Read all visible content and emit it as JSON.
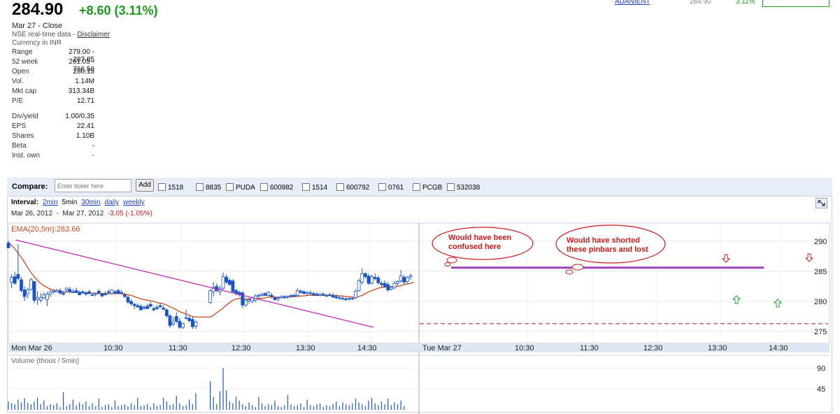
{
  "quote": {
    "price": "284.90",
    "change": "+8.60 (3.11%)",
    "close_label": "Mar 27 - Close",
    "source": "NSE real-time data - ",
    "disclaimer": "Disclaimer",
    "currency": "Currency in INR",
    "stats": [
      {
        "label": "Range",
        "value": "279.00 - 287.85"
      },
      {
        "label": "52 week",
        "value": "261.05 - 766.50"
      },
      {
        "label": "Open",
        "value": "280.15"
      },
      {
        "label": "Vol.",
        "value": "1.14M"
      },
      {
        "label": "Mkt cap",
        "value": "313.34B"
      },
      {
        "label": "P/E",
        "value": "12.71"
      },
      {
        "label": "Div/yield",
        "value": "1.00/0.35"
      },
      {
        "label": "EPS",
        "value": "22.41"
      },
      {
        "label": "Shares",
        "value": "1.10B"
      },
      {
        "label": "Beta",
        "value": "-"
      },
      {
        "label": "Inst. own",
        "value": "-"
      }
    ]
  },
  "peer": {
    "ticker": "ADANIENT",
    "price": "284.90",
    "change": "3.11%"
  },
  "compare": {
    "label": "Compare:",
    "placeholder": "Enter ticker here",
    "add_label": "Add",
    "tickers": [
      "1518",
      "8835",
      "PUDA",
      "600982",
      "1514",
      "600792",
      "0761",
      "PCGB",
      "532038"
    ]
  },
  "interval": {
    "label": "Interval:",
    "options": [
      "2min",
      "5min",
      "30min",
      "daily",
      "weekly"
    ],
    "selected": "5min",
    "start_date": "Mar 26, 2012",
    "end_date": "Mar 27, 2012",
    "period_change": "-3.05 (-1.05%)"
  },
  "colors": {
    "up": "#ffffff",
    "down": "#1a55c8",
    "ema": "#cc4a1a",
    "trendline": "#c020b0",
    "resistance": "#a040c0",
    "support": "#a0102a",
    "volume": "#1a55c8"
  },
  "chart_data": {
    "type": "candlestick",
    "ema_label": "EMA(20,5m):283.66",
    "y_ticks": [
      290,
      285,
      280,
      275
    ],
    "ylim": [
      273.5,
      293
    ],
    "x_labels": [
      "Mon Mar 26",
      "10:30",
      "11:30",
      "12:30",
      "13:30",
      "14:30",
      "Tue Mar 27",
      "10:30",
      "11:30",
      "12:30",
      "13:30",
      "14:30"
    ],
    "candles": [
      {
        "o": 289.7,
        "h": 290.1,
        "l": 288.9,
        "c": 288.9
      },
      {
        "o": 283.2,
        "h": 284.5,
        "l": 282.2,
        "c": 284.0
      },
      {
        "o": 284.1,
        "h": 284.9,
        "l": 282.8,
        "c": 283.0
      },
      {
        "o": 284.5,
        "h": 289.5,
        "l": 283.5,
        "c": 283.8
      },
      {
        "o": 283.6,
        "h": 284.0,
        "l": 281.5,
        "c": 281.8
      },
      {
        "o": 281.9,
        "h": 282.5,
        "l": 280.1,
        "c": 280.8
      },
      {
        "o": 281.3,
        "h": 282.3,
        "l": 280.5,
        "c": 281.9
      },
      {
        "o": 282.0,
        "h": 283.9,
        "l": 281.8,
        "c": 283.6
      },
      {
        "o": 283.3,
        "h": 283.4,
        "l": 279.7,
        "c": 280.2
      },
      {
        "o": 280.3,
        "h": 281.7,
        "l": 279.4,
        "c": 280.6
      },
      {
        "o": 280.2,
        "h": 281.4,
        "l": 279.8,
        "c": 280.6
      },
      {
        "o": 280.6,
        "h": 281.5,
        "l": 280.4,
        "c": 281.1
      },
      {
        "o": 280.3,
        "h": 281.6,
        "l": 279.2,
        "c": 281.2
      },
      {
        "o": 281.2,
        "h": 282.0,
        "l": 280.7,
        "c": 281.6
      },
      {
        "o": 281.6,
        "h": 281.9,
        "l": 281.3,
        "c": 281.7
      },
      {
        "o": 281.6,
        "h": 282.1,
        "l": 281.5,
        "c": 281.8
      },
      {
        "o": 281.8,
        "h": 282.2,
        "l": 281.1,
        "c": 281.4
      },
      {
        "o": 281.4,
        "h": 281.7,
        "l": 281.0,
        "c": 281.2
      },
      {
        "o": 281.9,
        "h": 282.3,
        "l": 281.4,
        "c": 282.2
      },
      {
        "o": 282.0,
        "h": 282.4,
        "l": 281.3,
        "c": 281.6
      },
      {
        "o": 281.6,
        "h": 282.1,
        "l": 281.4,
        "c": 281.5
      },
      {
        "o": 281.8,
        "h": 282.3,
        "l": 281.4,
        "c": 281.5
      },
      {
        "o": 281.5,
        "h": 281.8,
        "l": 281.0,
        "c": 281.1
      },
      {
        "o": 281.6,
        "h": 281.9,
        "l": 281.3,
        "c": 281.4
      },
      {
        "o": 281.4,
        "h": 281.7,
        "l": 280.9,
        "c": 281.2
      },
      {
        "o": 281.6,
        "h": 281.9,
        "l": 281.2,
        "c": 281.3
      },
      {
        "o": 281.1,
        "h": 281.4,
        "l": 280.9,
        "c": 281.0
      },
      {
        "o": 281.2,
        "h": 281.5,
        "l": 280.8,
        "c": 281.3
      },
      {
        "o": 281.7,
        "h": 282.0,
        "l": 281.3,
        "c": 281.4
      },
      {
        "o": 281.2,
        "h": 281.5,
        "l": 280.7,
        "c": 280.9
      },
      {
        "o": 281.3,
        "h": 281.7,
        "l": 281.0,
        "c": 281.1
      },
      {
        "o": 281.6,
        "h": 282.0,
        "l": 281.2,
        "c": 281.5
      },
      {
        "o": 281.3,
        "h": 282.0,
        "l": 281.1,
        "c": 281.9
      },
      {
        "o": 281.6,
        "h": 281.9,
        "l": 281.2,
        "c": 281.4
      },
      {
        "o": 281.8,
        "h": 282.1,
        "l": 281.2,
        "c": 281.3
      },
      {
        "o": 281.4,
        "h": 281.9,
        "l": 281.1,
        "c": 281.5
      },
      {
        "o": 281.1,
        "h": 281.4,
        "l": 280.6,
        "c": 280.8
      },
      {
        "o": 280.7,
        "h": 281.0,
        "l": 279.6,
        "c": 279.9
      },
      {
        "o": 280.0,
        "h": 280.3,
        "l": 279.3,
        "c": 279.6
      },
      {
        "o": 279.5,
        "h": 279.8,
        "l": 278.7,
        "c": 279.3
      },
      {
        "o": 279.3,
        "h": 279.7,
        "l": 278.9,
        "c": 279.1
      },
      {
        "o": 279.2,
        "h": 279.5,
        "l": 278.5,
        "c": 278.6
      },
      {
        "o": 279.0,
        "h": 279.4,
        "l": 278.6,
        "c": 278.9
      },
      {
        "o": 279.2,
        "h": 279.6,
        "l": 278.7,
        "c": 278.8
      },
      {
        "o": 279.5,
        "h": 279.9,
        "l": 279.0,
        "c": 279.2
      },
      {
        "o": 278.8,
        "h": 279.2,
        "l": 278.4,
        "c": 278.6
      },
      {
        "o": 279.0,
        "h": 279.4,
        "l": 278.6,
        "c": 278.8
      },
      {
        "o": 279.3,
        "h": 279.8,
        "l": 278.9,
        "c": 279.1
      },
      {
        "o": 278.9,
        "h": 279.4,
        "l": 278.5,
        "c": 278.7
      },
      {
        "o": 278.6,
        "h": 278.8,
        "l": 277.3,
        "c": 277.6
      },
      {
        "o": 277.6,
        "h": 277.9,
        "l": 275.6,
        "c": 276.0
      },
      {
        "o": 276.2,
        "h": 277.4,
        "l": 275.9,
        "c": 276.5
      },
      {
        "o": 277.5,
        "h": 278.2,
        "l": 276.4,
        "c": 276.7
      },
      {
        "o": 276.7,
        "h": 277.2,
        "l": 275.4,
        "c": 275.7
      },
      {
        "o": 275.7,
        "h": 276.5,
        "l": 275.4,
        "c": 276.3
      },
      {
        "o": 277.3,
        "h": 278.6,
        "l": 277.0,
        "c": 277.2
      },
      {
        "o": 277.2,
        "h": 277.6,
        "l": 276.5,
        "c": 276.8
      },
      {
        "o": 277.0,
        "h": 277.5,
        "l": 275.4,
        "c": 275.8
      },
      {
        "o": 275.9,
        "h": 276.8,
        "l": 275.4,
        "c": 276.6
      },
      {
        "o": 279.8,
        "h": 282.0,
        "l": 279.6,
        "c": 281.8
      },
      {
        "o": 281.6,
        "h": 283.2,
        "l": 280.8,
        "c": 282.3
      },
      {
        "o": 282.5,
        "h": 283.0,
        "l": 281.5,
        "c": 281.8
      },
      {
        "o": 281.6,
        "h": 282.6,
        "l": 281.0,
        "c": 282.1
      },
      {
        "o": 282.2,
        "h": 284.8,
        "l": 281.9,
        "c": 284.1
      },
      {
        "o": 284.0,
        "h": 284.5,
        "l": 282.9,
        "c": 283.2
      },
      {
        "o": 283.5,
        "h": 283.8,
        "l": 282.6,
        "c": 282.8
      },
      {
        "o": 283.4,
        "h": 283.7,
        "l": 281.5,
        "c": 281.6
      },
      {
        "o": 281.8,
        "h": 282.1,
        "l": 281.0,
        "c": 281.3
      },
      {
        "o": 281.5,
        "h": 281.8,
        "l": 280.8,
        "c": 281.1
      },
      {
        "o": 281.4,
        "h": 281.7,
        "l": 278.9,
        "c": 279.4
      },
      {
        "o": 279.4,
        "h": 280.4,
        "l": 279.1,
        "c": 280.2
      },
      {
        "o": 280.1,
        "h": 280.6,
        "l": 279.6,
        "c": 280.3
      },
      {
        "o": 280.0,
        "h": 280.8,
        "l": 279.7,
        "c": 280.6
      },
      {
        "o": 280.2,
        "h": 281.2,
        "l": 279.9,
        "c": 280.9
      },
      {
        "o": 280.9,
        "h": 281.3,
        "l": 280.5,
        "c": 281.0
      },
      {
        "o": 281.0,
        "h": 281.4,
        "l": 280.8,
        "c": 281.2
      },
      {
        "o": 281.3,
        "h": 281.5,
        "l": 280.9,
        "c": 281.0
      },
      {
        "o": 281.0,
        "h": 281.7,
        "l": 280.8,
        "c": 281.5
      },
      {
        "o": 281.0,
        "h": 281.4,
        "l": 280.6,
        "c": 280.8
      },
      {
        "o": 280.6,
        "h": 280.9,
        "l": 280.1,
        "c": 280.3
      },
      {
        "o": 280.4,
        "h": 280.8,
        "l": 280.0,
        "c": 280.6
      },
      {
        "o": 280.6,
        "h": 281.0,
        "l": 280.4,
        "c": 280.8
      },
      {
        "o": 280.8,
        "h": 281.1,
        "l": 280.5,
        "c": 280.6
      },
      {
        "o": 280.7,
        "h": 281.0,
        "l": 280.4,
        "c": 280.8
      },
      {
        "o": 280.9,
        "h": 281.2,
        "l": 280.6,
        "c": 281.0
      },
      {
        "o": 281.0,
        "h": 281.3,
        "l": 280.7,
        "c": 280.9
      },
      {
        "o": 281.0,
        "h": 282.2,
        "l": 280.8,
        "c": 281.8
      },
      {
        "o": 281.7,
        "h": 282.0,
        "l": 281.3,
        "c": 281.5
      },
      {
        "o": 281.6,
        "h": 281.9,
        "l": 281.2,
        "c": 281.3
      },
      {
        "o": 281.3,
        "h": 281.7,
        "l": 281.0,
        "c": 281.5
      },
      {
        "o": 281.4,
        "h": 281.8,
        "l": 281.1,
        "c": 281.3
      },
      {
        "o": 281.3,
        "h": 281.6,
        "l": 280.9,
        "c": 281.1
      },
      {
        "o": 281.2,
        "h": 281.5,
        "l": 280.9,
        "c": 281.0
      },
      {
        "o": 281.0,
        "h": 281.4,
        "l": 280.8,
        "c": 281.2
      },
      {
        "o": 281.2,
        "h": 281.5,
        "l": 280.9,
        "c": 281.1
      },
      {
        "o": 281.0,
        "h": 281.3,
        "l": 280.7,
        "c": 280.9
      },
      {
        "o": 281.1,
        "h": 281.4,
        "l": 280.8,
        "c": 281.0
      },
      {
        "o": 281.0,
        "h": 281.4,
        "l": 280.6,
        "c": 280.7
      },
      {
        "o": 280.8,
        "h": 281.1,
        "l": 280.4,
        "c": 280.6
      },
      {
        "o": 280.6,
        "h": 280.9,
        "l": 280.3,
        "c": 280.5
      },
      {
        "o": 280.5,
        "h": 280.8,
        "l": 280.2,
        "c": 280.4
      },
      {
        "o": 280.4,
        "h": 280.7,
        "l": 280.1,
        "c": 280.3
      },
      {
        "o": 280.4,
        "h": 280.7,
        "l": 280.1,
        "c": 280.5
      },
      {
        "o": 280.5,
        "h": 280.8,
        "l": 280.2,
        "c": 280.4
      },
      {
        "o": 280.6,
        "h": 282.0,
        "l": 280.4,
        "c": 281.7
      },
      {
        "o": 281.8,
        "h": 283.8,
        "l": 281.6,
        "c": 283.4
      },
      {
        "o": 283.2,
        "h": 285.5,
        "l": 282.8,
        "c": 284.6
      },
      {
        "o": 284.6,
        "h": 284.9,
        "l": 283.8,
        "c": 284.1
      },
      {
        "o": 284.2,
        "h": 284.6,
        "l": 282.7,
        "c": 283.0
      },
      {
        "o": 283.0,
        "h": 284.4,
        "l": 282.8,
        "c": 284.1
      },
      {
        "o": 284.0,
        "h": 284.6,
        "l": 283.5,
        "c": 283.8
      },
      {
        "o": 283.9,
        "h": 284.3,
        "l": 282.8,
        "c": 283.1
      },
      {
        "o": 283.0,
        "h": 283.4,
        "l": 282.4,
        "c": 282.8
      },
      {
        "o": 283.0,
        "h": 283.5,
        "l": 282.2,
        "c": 282.5
      },
      {
        "o": 282.8,
        "h": 283.2,
        "l": 281.6,
        "c": 281.9
      },
      {
        "o": 282.0,
        "h": 282.5,
        "l": 281.8,
        "c": 282.3
      },
      {
        "o": 282.3,
        "h": 283.4,
        "l": 282.0,
        "c": 283.0
      },
      {
        "o": 283.0,
        "h": 283.5,
        "l": 282.6,
        "c": 283.3
      },
      {
        "o": 283.4,
        "h": 285.2,
        "l": 283.1,
        "c": 284.2
      },
      {
        "o": 284.0,
        "h": 284.4,
        "l": 282.9,
        "c": 283.2
      },
      {
        "o": 283.3,
        "h": 284.2,
        "l": 283.0,
        "c": 284.0
      },
      {
        "o": 284.1,
        "h": 284.6,
        "l": 283.6,
        "c": 284.3
      }
    ],
    "ema": [
      289.8,
      289.3,
      288.7,
      288.0,
      287.3,
      286.5,
      285.6,
      284.8,
      284.1,
      283.5,
      283.0,
      282.6,
      282.3,
      282.0,
      281.9,
      281.8,
      281.7,
      281.6,
      281.6,
      281.6,
      281.5,
      281.5,
      281.5,
      281.5,
      281.4,
      281.4,
      281.4,
      281.3,
      281.3,
      281.3,
      281.3,
      281.3,
      281.3,
      281.3,
      281.3,
      281.3,
      281.2,
      281.1,
      281.0,
      280.8,
      280.6,
      280.4,
      280.3,
      280.2,
      280.1,
      280.0,
      279.8,
      279.7,
      279.6,
      279.4,
      279.1,
      278.9,
      278.6,
      278.3,
      278.1,
      277.9,
      277.7,
      277.5,
      277.4,
      277.4,
      277.7,
      278.1,
      278.5,
      278.9,
      279.4,
      279.8,
      280.2,
      280.4,
      280.5,
      280.5,
      280.4,
      280.4,
      280.4,
      280.4,
      280.5,
      280.5,
      280.6,
      280.7,
      280.7,
      280.7,
      280.7,
      280.7,
      280.7,
      280.8,
      280.8,
      280.8,
      280.8,
      280.9,
      280.9,
      281.0,
      281.0,
      281.0,
      281.0,
      281.0,
      281.0,
      281.0,
      281.0,
      281.0,
      281.0,
      280.9,
      280.9,
      280.8,
      280.8,
      280.7,
      280.7,
      280.8,
      281.0,
      281.3,
      281.6,
      281.8,
      282.0,
      282.2,
      282.3,
      282.4,
      282.5,
      282.5,
      282.5,
      282.5,
      282.6,
      282.8,
      282.9,
      283.0,
      283.2
    ],
    "volume_label": "Volume (thous / 5min)",
    "volume_ticks": [
      90,
      45
    ],
    "volume_ylim": [
      0,
      95
    ],
    "volume": [
      18,
      14,
      12,
      22,
      16,
      25,
      15,
      12,
      18,
      26,
      12,
      20,
      8,
      12,
      10,
      14,
      6,
      38,
      8,
      12,
      22,
      10,
      16,
      12,
      18,
      8,
      14,
      8,
      24,
      6,
      10,
      12,
      6,
      20,
      8,
      10,
      12,
      8,
      14,
      10,
      26,
      8,
      10,
      12,
      6,
      14,
      8,
      10,
      26,
      18,
      10,
      12,
      30,
      14,
      8,
      10,
      22,
      12,
      36,
      62,
      28,
      12,
      40,
      90,
      42,
      18,
      14,
      28,
      20,
      12,
      8,
      16,
      10,
      6,
      28,
      14,
      8,
      12,
      10,
      20,
      8,
      6,
      10,
      32,
      12,
      8,
      10,
      14,
      6,
      22,
      10,
      8,
      12,
      14,
      6,
      10,
      8,
      12,
      18,
      8,
      16,
      12,
      10,
      14,
      24,
      16,
      12,
      8,
      20,
      26,
      14,
      10,
      18,
      12,
      24,
      10,
      16,
      12,
      20,
      8
    ],
    "lines": {
      "downtrend": {
        "from": {
          "x": 12,
          "y": 290.2
        },
        "to": {
          "x": 126,
          "y": 275.7
        }
      },
      "resistance": {
        "from": {
          "x": 130,
          "y": 285.6
        },
        "to": {
          "x": 223,
          "y": 285.6
        },
        "value": 285.6
      },
      "support": {
        "from": {
          "x": 128,
          "y": 276.3
        },
        "to": {
          "x": 239,
          "y": 276.3
        },
        "value": 276.3
      }
    },
    "annotations": [
      {
        "label": "callout-1",
        "text": [
          "Would have been",
          "confused here"
        ]
      },
      {
        "label": "callout-2",
        "text": [
          "Would have shorted",
          "these pinbars and lost"
        ]
      }
    ]
  }
}
